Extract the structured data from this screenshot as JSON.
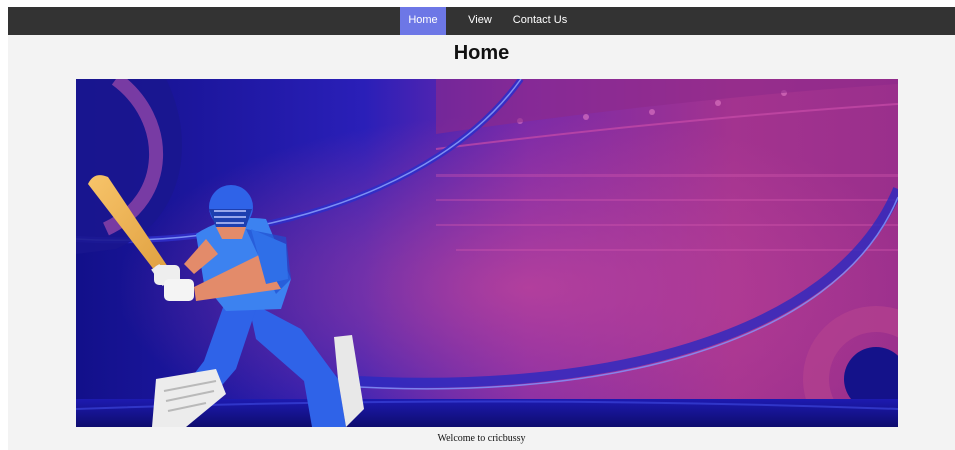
{
  "nav": {
    "items": [
      {
        "label": "Home",
        "active": true
      },
      {
        "label": "View",
        "active": false
      },
      {
        "label": "Contact Us",
        "active": false
      }
    ]
  },
  "page": {
    "title": "Home",
    "welcome_text": "Welcome to cricbussy"
  },
  "hero": {
    "icon": "cricket-batsman-illustration"
  },
  "colors": {
    "nav_background": "#333333",
    "nav_active": "#6d77e6",
    "page_background": "#f3f3f3",
    "hero_primary": "#1a1aa8",
    "hero_accent": "#b0338a"
  }
}
